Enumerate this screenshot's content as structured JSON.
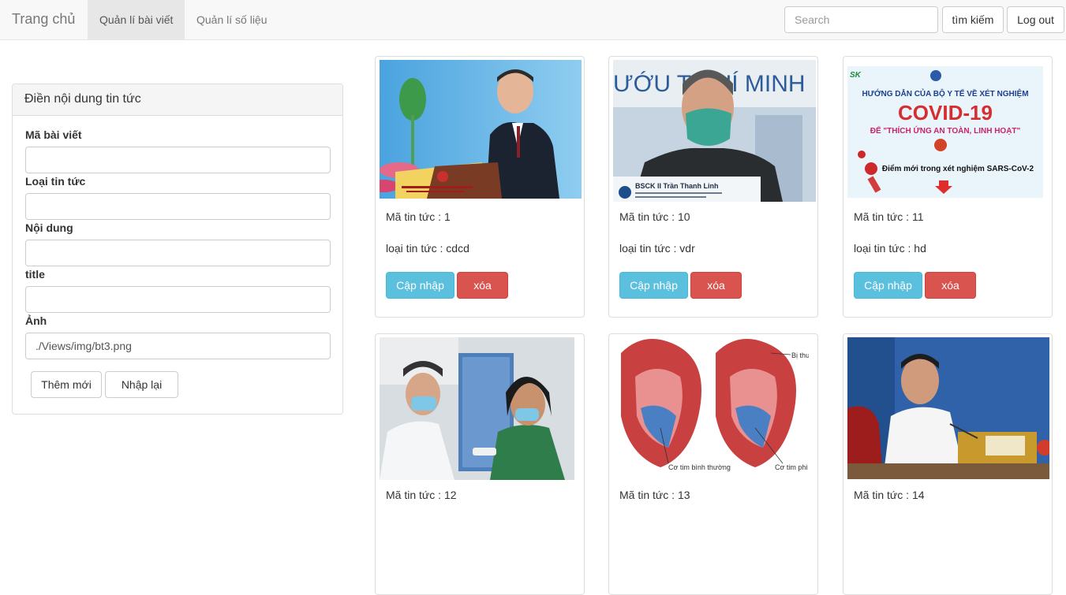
{
  "navbar": {
    "brand": "Trang chủ",
    "links": [
      "Quản lí bài viết",
      "Quản lí số liệu"
    ],
    "search_placeholder": "Search",
    "search_button": "tìm kiếm",
    "logout_button": "Log out"
  },
  "form": {
    "heading": "Điền nội dung tin tức",
    "fields": [
      {
        "label": "Mã bài viết",
        "value": ""
      },
      {
        "label": "Loại tin tức",
        "value": ""
      },
      {
        "label": "Nội dung",
        "value": ""
      },
      {
        "label": "title",
        "value": ""
      },
      {
        "label": "Ảnh",
        "value": "./Views/img/bt3.png"
      }
    ],
    "add_button": "Thêm mới",
    "reset_button": "Nhập lại"
  },
  "cards": [
    {
      "id_text": "Mã tin tức : 1",
      "type_text": "loại tin tức : cdcd",
      "image": "official-podium-photo"
    },
    {
      "id_text": "Mã tin tức : 10",
      "type_text": "loại tin tức : vdr",
      "image": "doctor-mask-photo"
    },
    {
      "id_text": "Mã tin tức : 11",
      "type_text": "loại tin tức : hd",
      "image": "covid-poster"
    },
    {
      "id_text": "Mã tin tức : 12",
      "type_text": "",
      "image": "vaccination-photo"
    },
    {
      "id_text": "Mã tin tức : 13",
      "type_text": "",
      "image": "heart-diagram"
    },
    {
      "id_text": "Mã tin tức : 14",
      "type_text": "",
      "image": "official-speech-photo"
    }
  ],
  "card_buttons": {
    "update": "Cập nhập",
    "delete": "xóa"
  },
  "poster": {
    "logo": "SK",
    "line1": "HƯỚNG DẪN CỦA BỘ Y TẾ VỀ XÉT NGHIỆM",
    "line2": "COVID-19",
    "line3": "ĐỂ \"THÍCH ỨNG AN TOÀN, LINH HOẠT\"",
    "line4": "Điểm mới trong xét nghiệm SARS-CoV-2"
  },
  "photo_text": {
    "banner_10": "ƯỚU T   CHÍ MINH",
    "caption_10": "BSCK II Trần Thanh Linh",
    "heart_label_left": "Cơ tim bình thường",
    "heart_label_right": "Cơ tim phì",
    "heart_label_top": "Bị thu"
  },
  "colors": {
    "info": "#5bc0de",
    "danger": "#d9534f",
    "navbar_bg": "#f8f8f8"
  }
}
